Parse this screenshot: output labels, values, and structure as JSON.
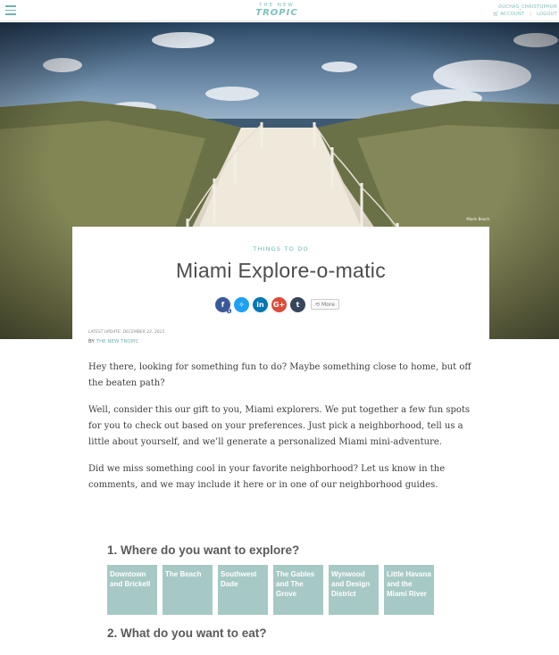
{
  "header": {
    "logo_line1": "THE NEW",
    "logo_line2": "TROPIC",
    "user_name": "DUCHAS_CHRISTOPHOR",
    "account_link": "ACCOUNT",
    "logout_link": "LOGOUT",
    "separator": "|"
  },
  "hero": {
    "credit": "Miami Beach"
  },
  "article": {
    "section": "THINGS TO DO",
    "title": "Miami Explore-o-matic",
    "facebook_count": "1",
    "more_label": "More",
    "latest_update": "LATEST UPDATE: DECEMBER 22, 2015",
    "by_prefix": "BY",
    "author": "THE NEW TROPIC",
    "paragraphs": [
      "Hey there, looking for something fun to do? Maybe something close to home, but off the beaten path?",
      "Well, consider this our gift to you, Miami explorers. We put together a few fun spots for you to check out based on your preferences. Just pick a neighborhood, tell us a little about yourself, and we’ll generate a personalized Miami mini-adventure.",
      "Did we miss something cool in your favorite neighborhood? Let us know in the comments, and we may include it here or in one of our neighborhood guides."
    ]
  },
  "explore": {
    "question1": "1. Where do you want to explore?",
    "neighborhoods": [
      "Downtown and Brickell",
      "The Beach",
      "Southwest Dade",
      "The Gables and The Grove",
      "Wynwood and Design District",
      "Little Havana and the Miami River"
    ],
    "question2": "2. What do you want to eat?"
  },
  "colors": {
    "accent": "#6fb4b1",
    "tile": "#a7c9c6",
    "facebook": "#3b5998",
    "twitter": "#1da1f2",
    "linkedin": "#0077b5",
    "googleplus": "#dd4b39",
    "tumblr": "#35465c"
  },
  "icons": [
    "menu-icon",
    "facebook-icon",
    "twitter-icon",
    "linkedin-icon",
    "google-plus-icon",
    "tumblr-icon",
    "share-icon",
    "cart-icon"
  ]
}
